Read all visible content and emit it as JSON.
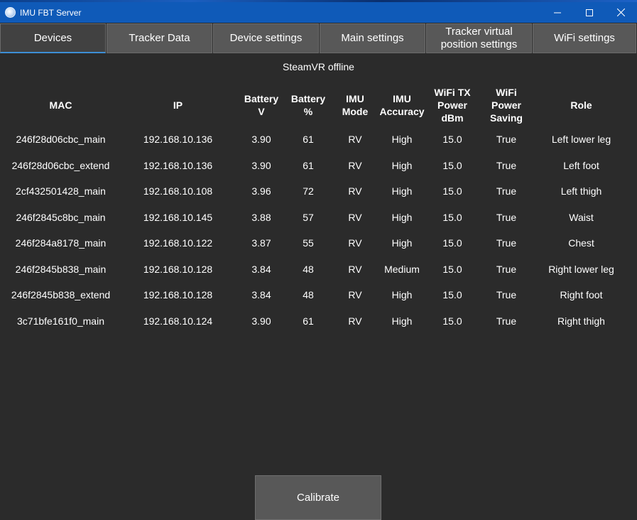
{
  "window": {
    "title": "IMU FBT Server",
    "controls": {
      "minimize": "minimize-icon",
      "maximize": "maximize-icon",
      "close": "close-icon"
    }
  },
  "tabs": [
    {
      "label": "Devices",
      "active": true
    },
    {
      "label": "Tracker Data",
      "active": false
    },
    {
      "label": "Device settings",
      "active": false
    },
    {
      "label": "Main settings",
      "active": false
    },
    {
      "label": "Tracker virtual\nposition settings",
      "active": false
    },
    {
      "label": "WiFi settings",
      "active": false
    }
  ],
  "status": "SteamVR offline",
  "table": {
    "headers": [
      "MAC",
      "IP",
      "Battery\nV",
      "Battery\n%",
      "IMU\nMode",
      "IMU\nAccuracy",
      "WiFi TX\nPower\ndBm",
      "WiFi\nPower\nSaving",
      "Role"
    ],
    "rows": [
      [
        "246f28d06cbc_main",
        "192.168.10.136",
        "3.90",
        "61",
        "RV",
        "High",
        "15.0",
        "True",
        "Left lower leg"
      ],
      [
        "246f28d06cbc_extend",
        "192.168.10.136",
        "3.90",
        "61",
        "RV",
        "High",
        "15.0",
        "True",
        "Left foot"
      ],
      [
        "2cf432501428_main",
        "192.168.10.108",
        "3.96",
        "72",
        "RV",
        "High",
        "15.0",
        "True",
        "Left thigh"
      ],
      [
        "246f2845c8bc_main",
        "192.168.10.145",
        "3.88",
        "57",
        "RV",
        "High",
        "15.0",
        "True",
        "Waist"
      ],
      [
        "246f284a8178_main",
        "192.168.10.122",
        "3.87",
        "55",
        "RV",
        "High",
        "15.0",
        "True",
        "Chest"
      ],
      [
        "246f2845b838_main",
        "192.168.10.128",
        "3.84",
        "48",
        "RV",
        "Medium",
        "15.0",
        "True",
        "Right lower leg"
      ],
      [
        "246f2845b838_extend",
        "192.168.10.128",
        "3.84",
        "48",
        "RV",
        "High",
        "15.0",
        "True",
        "Right foot"
      ],
      [
        "3c71bfe161f0_main",
        "192.168.10.124",
        "3.90",
        "61",
        "RV",
        "High",
        "15.0",
        "True",
        "Right thigh"
      ]
    ]
  },
  "calibrate_label": "Calibrate",
  "colors": {
    "titlebar": "#0f5ab8",
    "background": "#2b2b2b",
    "tab": "#585858",
    "tab_active": "#414141",
    "tab_active_underline": "#3d8fd6",
    "button": "#585858"
  }
}
